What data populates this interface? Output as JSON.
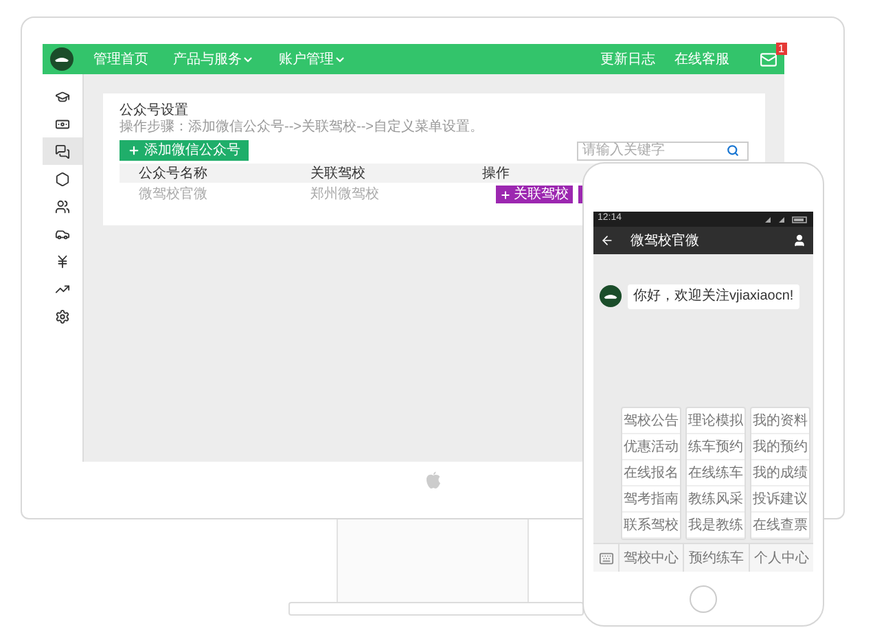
{
  "topbar": {
    "nav": [
      {
        "label": "管理首页",
        "dropdown": false
      },
      {
        "label": "产品与服务",
        "dropdown": true
      },
      {
        "label": "账户管理",
        "dropdown": true
      }
    ],
    "links": [
      "更新日志",
      "在线客服"
    ],
    "mail_badge": "1"
  },
  "sidebar": {
    "items": [
      {
        "selected": false
      },
      {
        "selected": false
      },
      {
        "selected": true
      },
      {
        "selected": false
      },
      {
        "selected": false
      },
      {
        "selected": false
      },
      {
        "selected": false
      },
      {
        "selected": false
      },
      {
        "selected": false
      }
    ]
  },
  "panel": {
    "title": "公众号设置",
    "hint": "操作步骤：添加微信公众号-->关联驾校-->自定义菜单设置。",
    "add_button": "添加微信公众号",
    "search": {
      "placeholder": "请输入关键字"
    },
    "table": {
      "columns": [
        "公众号名称",
        "关联驾校",
        "操作"
      ],
      "rows": [
        {
          "name": "微驾校官微",
          "school": "郑州微驾校",
          "action": "关联驾校"
        }
      ]
    }
  },
  "phone": {
    "time": "12:14",
    "title": "微驾校官微",
    "message": "你好，欢迎关注vjiaxiaocn!",
    "menus": [
      {
        "label": "驾校中心",
        "items": [
          "驾校公告",
          "优惠活动",
          "在线报名",
          "驾考指南",
          "联系驾校"
        ]
      },
      {
        "label": "预约练车",
        "items": [
          "理论模拟",
          "练车预约",
          "在线练车",
          "教练风采",
          "我是教练"
        ]
      },
      {
        "label": "个人中心",
        "items": [
          "我的资料",
          "我的预约",
          "我的成绩",
          "投诉建议",
          "在线查票"
        ]
      }
    ]
  }
}
